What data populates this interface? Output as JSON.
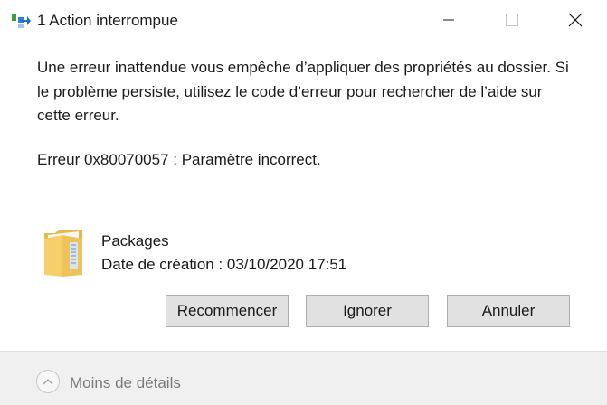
{
  "window": {
    "title": "1 Action interrompue",
    "icon": "file-transfer-icon"
  },
  "message": {
    "body": "Une erreur inattendue vous empêche d’appliquer des propriétés au dossier. Si le problème persiste, utilisez le code d’erreur pour rechercher de l’aide sur cette erreur.",
    "error": "Erreur 0x80070057 : Paramètre incorrect."
  },
  "item": {
    "icon": "folder-icon",
    "name": "Packages",
    "created": "Date de création : 03/10/2020 17:51"
  },
  "buttons": {
    "retry": "Recommencer",
    "skip": "Ignorer",
    "cancel": "Annuler"
  },
  "footer": {
    "toggle_label": "Moins de détails"
  },
  "colors": {
    "button_bg": "#e1e1e1",
    "button_border": "#adadad",
    "footer_bg": "#f0f0f0",
    "muted_text": "#7a7a7a"
  }
}
